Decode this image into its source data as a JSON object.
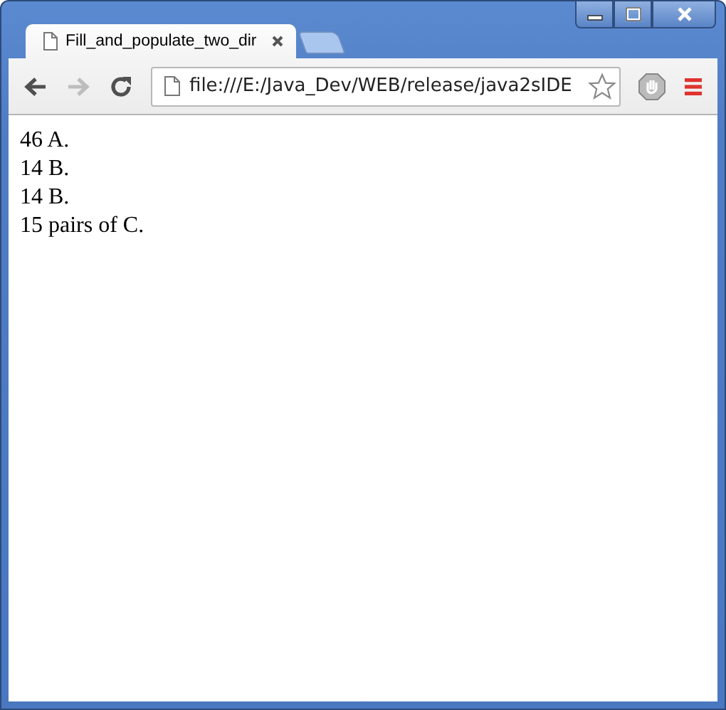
{
  "tabs": [
    {
      "title": "Fill_and_populate_two_dir",
      "selected": true
    }
  ],
  "toolbar": {
    "back": {
      "disabled": false
    },
    "forward": {
      "disabled": true
    }
  },
  "address_bar": {
    "value": "file:///E:/Java_Dev/WEB/release/java2sIDE"
  },
  "page": {
    "lines": [
      "46 A.",
      "14 B.",
      "14 B.",
      "15 pairs of C."
    ]
  }
}
